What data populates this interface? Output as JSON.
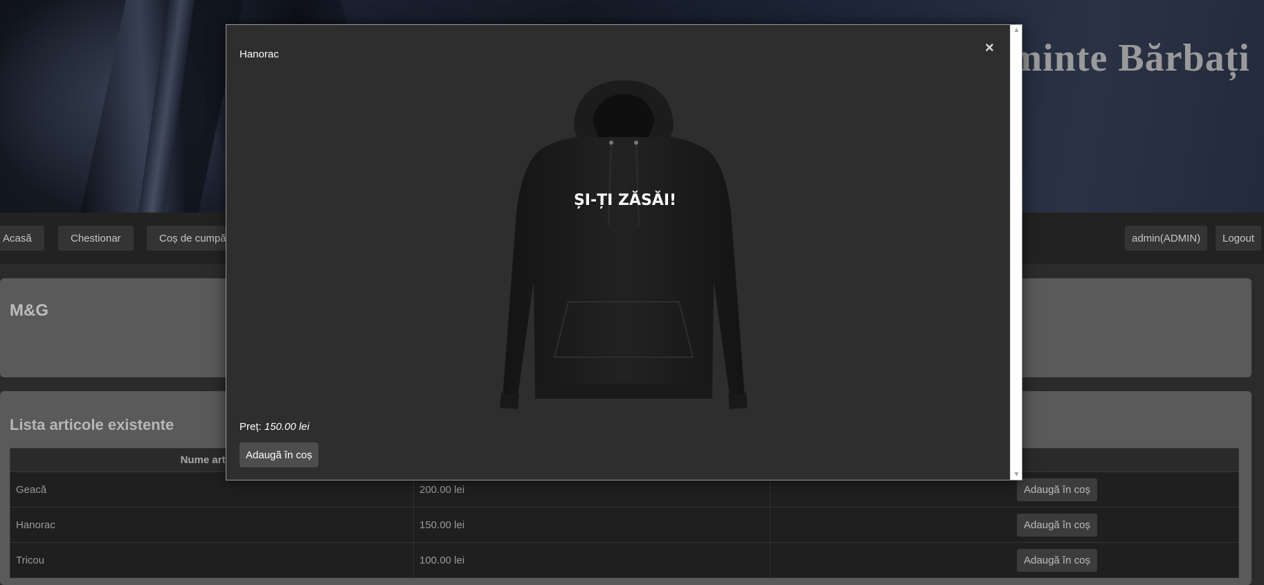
{
  "header": {
    "title": "Îmbrăcăminte Bărbați"
  },
  "nav": {
    "home": "Acasă",
    "survey": "Chestionar",
    "cart": "Coș de cumpărături",
    "user": "admin(ADMIN)",
    "logout": "Logout"
  },
  "about": {
    "title": "M&G"
  },
  "articles": {
    "title": "Lista articole existente",
    "headers": [
      "Nume articol",
      "",
      ""
    ],
    "rows": [
      {
        "name": "Geacă",
        "price": "200.00 lei",
        "action": "Adaugă în coș"
      },
      {
        "name": "Hanorac",
        "price": "150.00 lei",
        "action": "Adaugă în coș"
      },
      {
        "name": "Tricou",
        "price": "100.00 lei",
        "action": "Adaugă în coș"
      }
    ]
  },
  "modal": {
    "title": "Hanorac",
    "close": "×",
    "image_text": "ȘI-ȚI ZĂSĂI!",
    "price_label": "Preț:",
    "price_value": "150.00 lei",
    "add_label": "Adaugă în coș"
  }
}
